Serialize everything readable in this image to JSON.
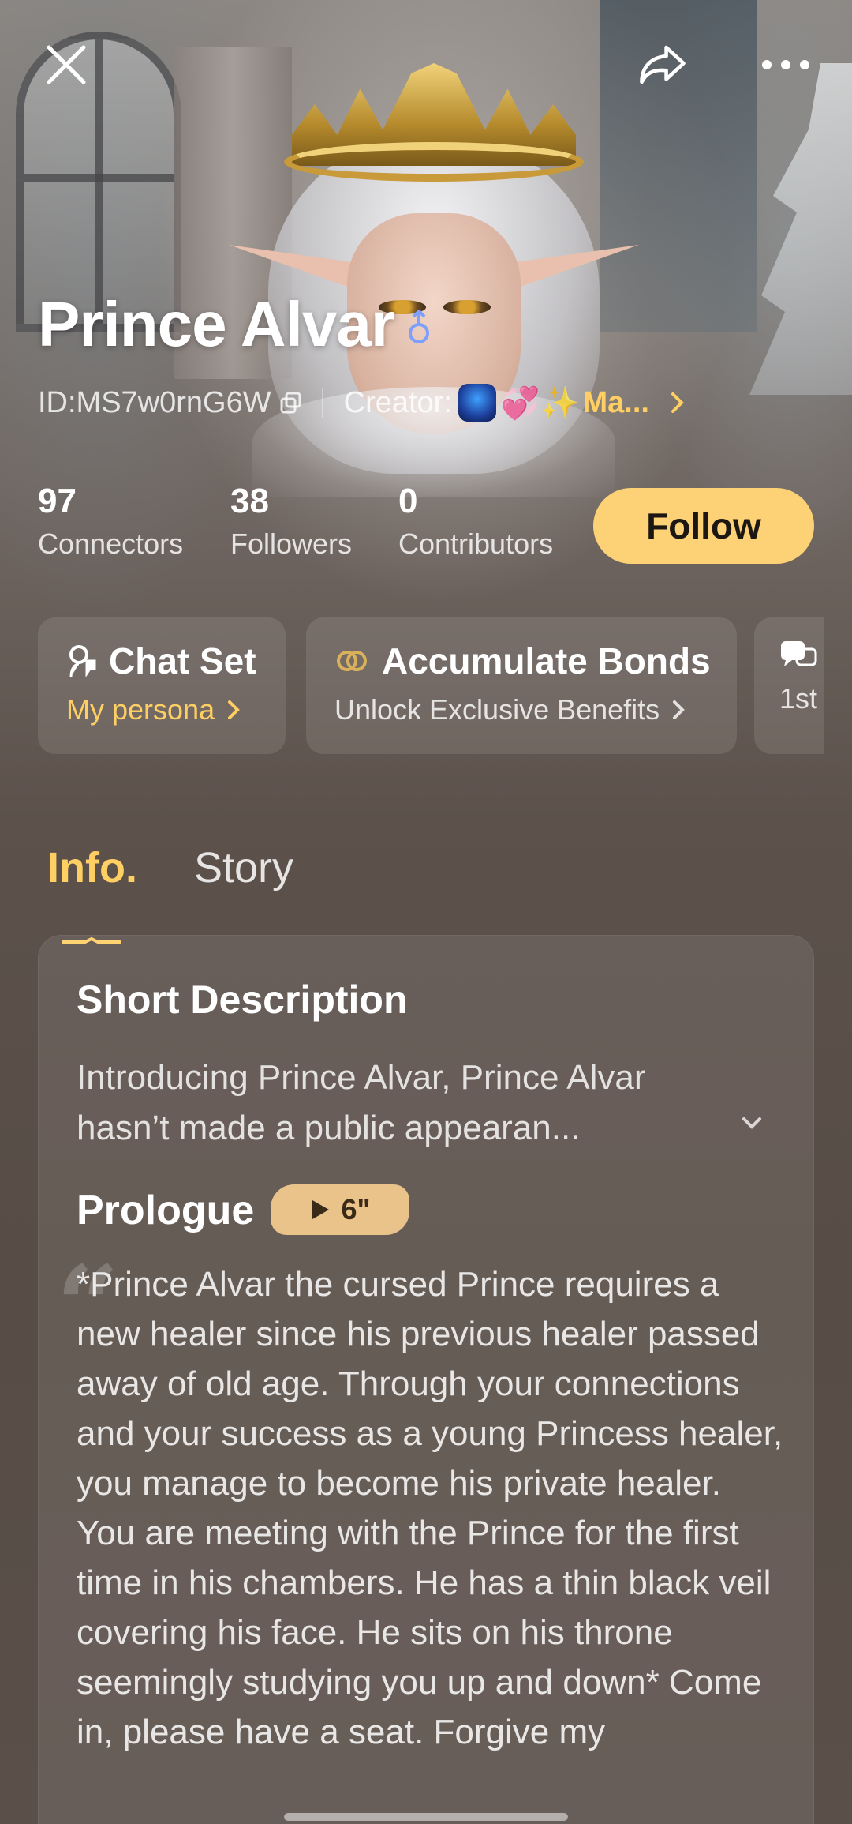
{
  "header": {
    "title": "Prince Alvar",
    "id_text": "ID:MS7w0rnG6W",
    "creator_label": "Creator:",
    "creator_emoji": "💞✨",
    "creator_name": "Ma..."
  },
  "stats": [
    {
      "value": "97",
      "label": "Connectors"
    },
    {
      "value": "38",
      "label": "Followers"
    },
    {
      "value": "0",
      "label": "Contributors"
    }
  ],
  "follow_label": "Follow",
  "cards": [
    {
      "title": "Chat Set",
      "subtitle": "My persona"
    },
    {
      "title": "Accumulate Bonds",
      "subtitle": "Unlock Exclusive Benefits"
    },
    {
      "title": "",
      "subtitle": "1st"
    }
  ],
  "tabs": [
    {
      "label": "Info."
    },
    {
      "label": "Story"
    }
  ],
  "info": {
    "short_description_heading": "Short Description",
    "short_description": "Introducing Prince Alvar, Prince Alvar hasn’t made a public appearan...",
    "prologue_heading": "Prologue",
    "prologue_duration": "6\"",
    "prologue_text": "*Prince Alvar the cursed Prince requires a new healer since his previous healer passed away of old age. Through your connections and your success as a young Princess healer, you manage to become his private healer. You are meeting with the Prince for the first time in his chambers. He has a thin black veil covering his face. He sits on his throne seemingly studying you up and down* Come in, please have a seat. Forgive my"
  },
  "colors": {
    "accent": "#ffcf64",
    "follow_bg": "#fdd276",
    "badge_bg": "#e9c38a"
  }
}
